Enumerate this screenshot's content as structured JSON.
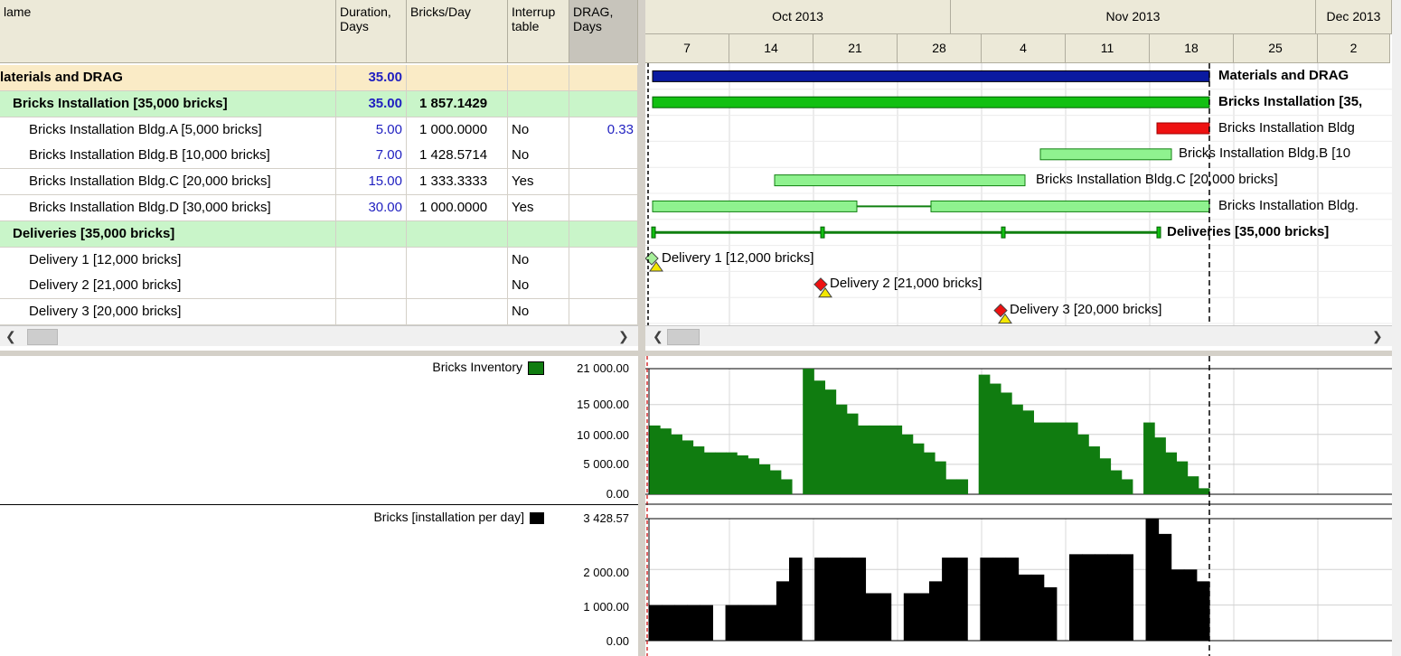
{
  "table": {
    "headers": {
      "name": "lame",
      "duration": "Duration,\nDays",
      "bricks_day": "Bricks/Day",
      "interruptable": "Interrup\ntable",
      "drag": "DRAG,\nDays"
    },
    "rows": [
      {
        "name": "laterials and DRAG",
        "duration": "35.00",
        "bricks_day": "",
        "interruptable": "",
        "drag": "",
        "style": "summary1"
      },
      {
        "name": "Bricks Installation [35,000 bricks]",
        "duration": "35.00",
        "bricks_day": "1 857.1429",
        "interruptable": "",
        "drag": "",
        "style": "summary2"
      },
      {
        "name": "Bricks Installation  Bldg.A [5,000 bricks]",
        "duration": "5.00",
        "bricks_day": "1 000.0000",
        "interruptable": "No",
        "drag": "0.33",
        "style": "task"
      },
      {
        "name": "Bricks Installation Bldg.B [10,000 bricks]",
        "duration": "7.00",
        "bricks_day": "1 428.5714",
        "interruptable": "No",
        "drag": "",
        "style": "task"
      },
      {
        "name": "Bricks Installation Bldg.C [20,000 bricks]",
        "duration": "15.00",
        "bricks_day": "1 333.3333",
        "interruptable": "Yes",
        "drag": "",
        "style": "task"
      },
      {
        "name": "Bricks Installation Bldg.D [30,000 bricks]",
        "duration": "30.00",
        "bricks_day": "1 000.0000",
        "interruptable": "Yes",
        "drag": "",
        "style": "task"
      },
      {
        "name": "Deliveries [35,000 bricks]",
        "duration": "",
        "bricks_day": "",
        "interruptable": "",
        "drag": "",
        "style": "summary2"
      },
      {
        "name": "Delivery 1 [12,000 bricks]",
        "duration": "",
        "bricks_day": "",
        "interruptable": "No",
        "drag": "",
        "style": "task"
      },
      {
        "name": "Delivery 2 [21,000 bricks]",
        "duration": "",
        "bricks_day": "",
        "interruptable": "No",
        "drag": "",
        "style": "task"
      },
      {
        "name": "Delivery 3 [20,000 bricks]",
        "duration": "",
        "bricks_day": "",
        "interruptable": "No",
        "drag": "",
        "style": "task"
      }
    ]
  },
  "timeline": {
    "months": [
      "Oct 2013",
      "Nov 2013",
      "Dec 2013"
    ],
    "days": [
      "7",
      "14",
      "21",
      "28",
      "4",
      "11",
      "18",
      "25",
      "2"
    ]
  },
  "gantt": {
    "labels": [
      "Materials and DRAG",
      "Bricks Installation [35,",
      "Bricks Installation  Bldg",
      "Bricks Installation Bldg.B [10",
      "Bricks Installation Bldg.C [20,000 bricks]",
      "Bricks Installation Bldg.",
      "Deliveries [35,000 bricks]",
      "Delivery 1 [12,000 bricks]",
      "Delivery 2 [21,000 bricks]",
      "Delivery 3 [20,000 bricks]"
    ]
  },
  "charts": {
    "inventory": {
      "legend": "Bricks Inventory",
      "color": "#107c10",
      "ticks": [
        "21 000.00",
        "15 000.00",
        "10 000.00",
        "5 000.00",
        "0.00"
      ]
    },
    "installation": {
      "legend": "Bricks [installation per day]",
      "color": "#000000",
      "ticks": [
        "3 428.57",
        "2 000.00",
        "1 000.00",
        "0.00"
      ]
    }
  },
  "chart_data": [
    {
      "type": "area",
      "series": [
        {
          "name": "Bricks Inventory",
          "values": [
            11500,
            11000,
            10000,
            9000,
            8000,
            7000,
            7000,
            7000,
            6500,
            6000,
            5000,
            4000,
            2500,
            0,
            21000,
            19000,
            17500,
            15000,
            13500,
            11500,
            11500,
            11500,
            11500,
            10000,
            8500,
            7000,
            5500,
            2500,
            2500,
            0,
            20000,
            18500,
            17000,
            15000,
            14000,
            12000,
            12000,
            12000,
            12000,
            10000,
            8000,
            6000,
            4000,
            2500,
            0,
            12000,
            9500,
            7000,
            5500,
            3000,
            1000
          ]
        }
      ],
      "ylim": [
        0,
        21000
      ]
    },
    {
      "type": "bar",
      "series": [
        {
          "name": "Bricks [installation per day]",
          "values": [
            1000,
            1000,
            1000,
            1000,
            1000,
            0,
            1000,
            1000,
            1000,
            1000,
            1667,
            2333,
            0,
            2333,
            2333,
            2333,
            2333,
            1333,
            1333,
            0,
            1333,
            1333,
            1667,
            2333,
            2333,
            0,
            2333,
            2333,
            2333,
            1857,
            1857,
            1500,
            0,
            2429,
            2429,
            2429,
            2429,
            2429,
            0,
            3429,
            3000,
            2000,
            2000,
            1667
          ]
        }
      ],
      "ylim": [
        0,
        3428.57
      ]
    }
  ]
}
